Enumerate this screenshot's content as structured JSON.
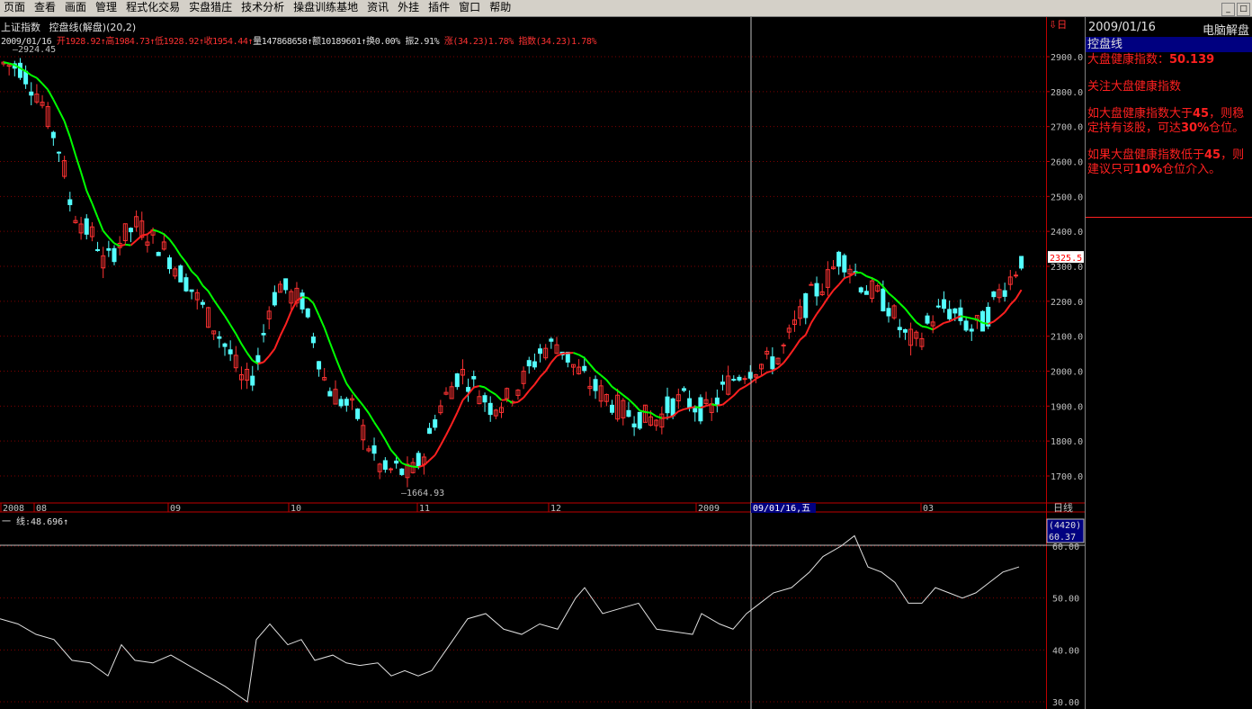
{
  "menu": [
    "页面",
    "查看",
    "画面",
    "管理",
    "程式化交易",
    "实盘猎庄",
    "技术分析",
    "操盘训练基地",
    "资讯",
    "外挂",
    "插件",
    "窗口",
    "帮助"
  ],
  "window_buttons": [
    "_",
    "□"
  ],
  "header": {
    "index_name": "上证指数",
    "indicator": "控盘线(解盘)(20,2)"
  },
  "info": {
    "date": "2009/01/16",
    "open": "开1928.92↑",
    "high": "高1984.73↑",
    "low": "低1928.92↑",
    "close": "收1954.44↑",
    "volume": "量147868658↑",
    "amount": "额10189601↑",
    "turnover": "换0.00%",
    "amplitude": "振2.91%",
    "change": "涨(34.23)1.78%",
    "index": "指数(34.23)1.78%"
  },
  "annotations": {
    "high": "2924.45",
    "low": "1664.93"
  },
  "price_axis": {
    "ticks": [
      "2900.0",
      "2800.0",
      "2700.0",
      "2600.0",
      "2500.0",
      "2400.0",
      "2300.0",
      "2200.0",
      "2100.0",
      "2000.0",
      "1900.0",
      "1800.0",
      "1700.0"
    ],
    "current": "2325.5",
    "top_icon": "⇩日"
  },
  "time_axis": {
    "labels": [
      "2008",
      "08",
      "09",
      "10",
      "11",
      "12",
      "2009",
      "03"
    ],
    "cursor_label": "09/01/16,五",
    "period": "日线"
  },
  "indicator_panel": {
    "label": "一 线:48.696↑",
    "count": "(4420)",
    "cursor_value": "60.37",
    "ticks": [
      "60.00",
      "50.00",
      "40.00",
      "30.00"
    ]
  },
  "side_panel": {
    "date": "2009/01/16",
    "title": "电脑解盘",
    "tab": "控盘线",
    "health_label": "大盘健康指数：",
    "health_value": "50.139",
    "heading": "关注大盘健康指数",
    "p1_a": "  如大盘健康指数大于",
    "p1_b": "45",
    "p1_c": "，则稳定持有该股，可达",
    "p1_d": "30%",
    "p1_e": "仓位。",
    "p2_a": "  如果大盘健康指数低于",
    "p2_b": "45",
    "p2_c": "，则建议只可",
    "p2_d": "10%",
    "p2_e": "仓位介入。"
  },
  "colors": {
    "up": "#ff3232",
    "down": "#54ffff",
    "ma_up": "#ff2020",
    "ma_green": "#00ff00",
    "ma_yellow": "#ffff00",
    "grid": "#800000",
    "axis": "#c00000",
    "text": "#c0c0c0"
  }
}
